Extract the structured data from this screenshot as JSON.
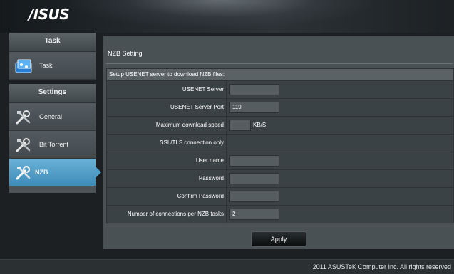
{
  "header": {
    "logo": "/ISUS"
  },
  "sidebar": {
    "task_header": "Task",
    "task_item": {
      "label": "Task",
      "icon": "task-icon"
    },
    "settings_header": "Settings",
    "items": [
      {
        "label": "General",
        "icon": "tools-icon"
      },
      {
        "label": "Bit Torrent",
        "icon": "tools-icon"
      },
      {
        "label": "NZB",
        "icon": "tools-icon",
        "active": true
      }
    ]
  },
  "main": {
    "title": "NZB Setting",
    "form_header": "Setup USENET server to download NZB files:",
    "rows": [
      {
        "label": "USENET Server",
        "value": ""
      },
      {
        "label": "USENET Server Port",
        "value": "119"
      },
      {
        "label": "Maximum download speed",
        "value": "",
        "unit": "KB/S"
      },
      {
        "label": "SSL/TLS connection only"
      },
      {
        "label": "User name",
        "value": ""
      },
      {
        "label": "Password",
        "value": ""
      },
      {
        "label": "Confirm Password",
        "value": ""
      },
      {
        "label": "Number of connections per NZB tasks",
        "value": "2"
      }
    ],
    "apply_label": "Apply"
  },
  "footer": {
    "copyright": "2011 ASUSTeK Computer Inc. All rights reserved"
  },
  "colors": {
    "active": "#4d9dc8",
    "panel": "#4a5155",
    "background": "#1c2023"
  }
}
